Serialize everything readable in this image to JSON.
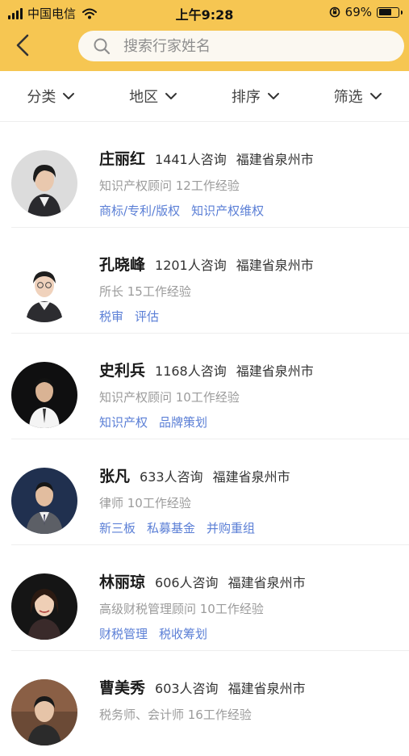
{
  "status_bar": {
    "carrier": "中国电信",
    "time": "上午9:28",
    "battery": "69%",
    "battery_level": 0.69,
    "icons": [
      "signal-icon",
      "wifi-icon",
      "orientation-lock-icon",
      "battery-icon"
    ]
  },
  "header": {
    "back_icon": "chevron-left-icon",
    "search_icon": "search-icon",
    "search_placeholder": "搜索行家姓名",
    "search_value": ""
  },
  "filters": [
    {
      "label": "分类",
      "icon": "chevron-down-icon"
    },
    {
      "label": "地区",
      "icon": "chevron-down-icon"
    },
    {
      "label": "排序",
      "icon": "chevron-down-icon"
    },
    {
      "label": "筛选",
      "icon": "chevron-down-icon"
    }
  ],
  "experts": [
    {
      "name": "庄丽红",
      "consultations": "1441人咨询",
      "location": "福建省泉州市",
      "title": "知识产权顾问 12工作经验",
      "tags": [
        "商标/专利/版权",
        "知识产权维权"
      ]
    },
    {
      "name": "孔晓峰",
      "consultations": "1201人咨询",
      "location": "福建省泉州市",
      "title": "所长 15工作经验",
      "tags": [
        "税审",
        "评估"
      ]
    },
    {
      "name": "史利兵",
      "consultations": "1168人咨询",
      "location": "福建省泉州市",
      "title": "知识产权顾问 10工作经验",
      "tags": [
        "知识产权",
        "品牌策划"
      ]
    },
    {
      "name": "张凡",
      "consultations": "633人咨询",
      "location": "福建省泉州市",
      "title": "律师 10工作经验",
      "tags": [
        "新三板",
        "私募基金",
        "并购重组"
      ]
    },
    {
      "name": "林丽琼",
      "consultations": "606人咨询",
      "location": "福建省泉州市",
      "title": "高级财税管理顾问 10工作经验",
      "tags": [
        "财税管理",
        "税收筹划"
      ]
    },
    {
      "name": "曹美秀",
      "consultations": "603人咨询",
      "location": "福建省泉州市",
      "title": "税务师、会计师 16工作经验",
      "tags": []
    }
  ],
  "colors": {
    "header_bg": "#f6c652",
    "tag_blue": "#5b7fd6",
    "muted_text": "#9b9b9b"
  }
}
